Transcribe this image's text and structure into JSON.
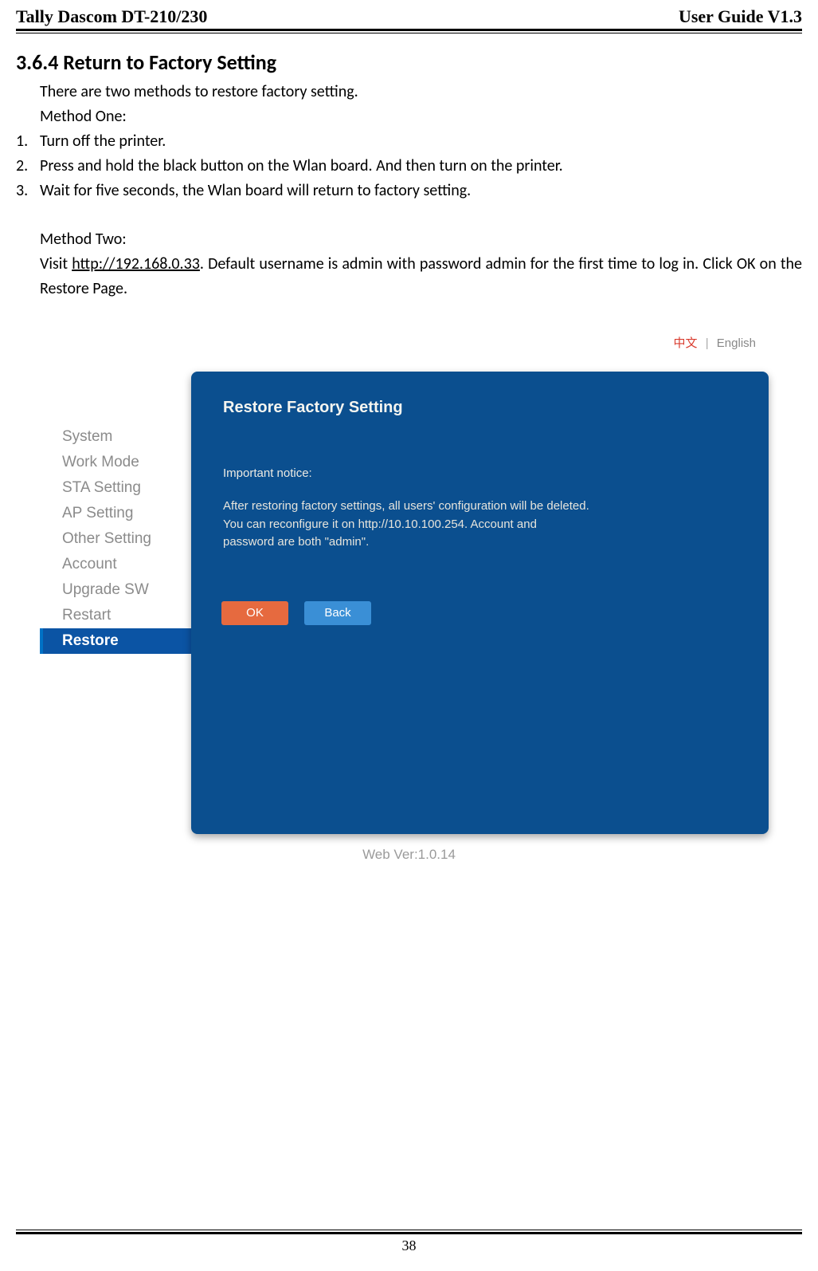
{
  "header": {
    "left": "Tally Dascom DT-210/230",
    "right": "User Guide V1.3"
  },
  "section": {
    "heading": "3.6.4 Return to Factory Setting",
    "intro": "There are two methods to restore factory setting.",
    "method_one_label": "Method One:",
    "steps": [
      "Turn off the printer.",
      "Press and hold the black button on the Wlan board. And then turn on the printer.",
      "Wait for five seconds, the Wlan board will return to factory setting."
    ],
    "method_two_label": "Method Two:",
    "method_two_prefix": "Visit ",
    "method_two_link": "http://192.168.0.33",
    "method_two_suffix": ". Default username is admin with password admin for the first time to log in. Click OK on the Restore Page."
  },
  "ui": {
    "lang_cn": "中文",
    "lang_sep": "|",
    "lang_en": "English",
    "sidebar": [
      "System",
      "Work Mode",
      "STA Setting",
      "AP Setting",
      "Other Setting",
      "Account",
      "Upgrade SW",
      "Restart",
      "Restore"
    ],
    "active_index": 8,
    "panel": {
      "title": "Restore Factory Setting",
      "notice_label": "Important notice:",
      "notice_body": "After restoring factory settings, all users' configuration will be deleted. You can reconfigure it on http://10.10.100.254. Account and password are both \"admin\".",
      "ok": "OK",
      "back": "Back"
    },
    "web_ver": "Web Ver:1.0.14"
  },
  "page_number": "38"
}
